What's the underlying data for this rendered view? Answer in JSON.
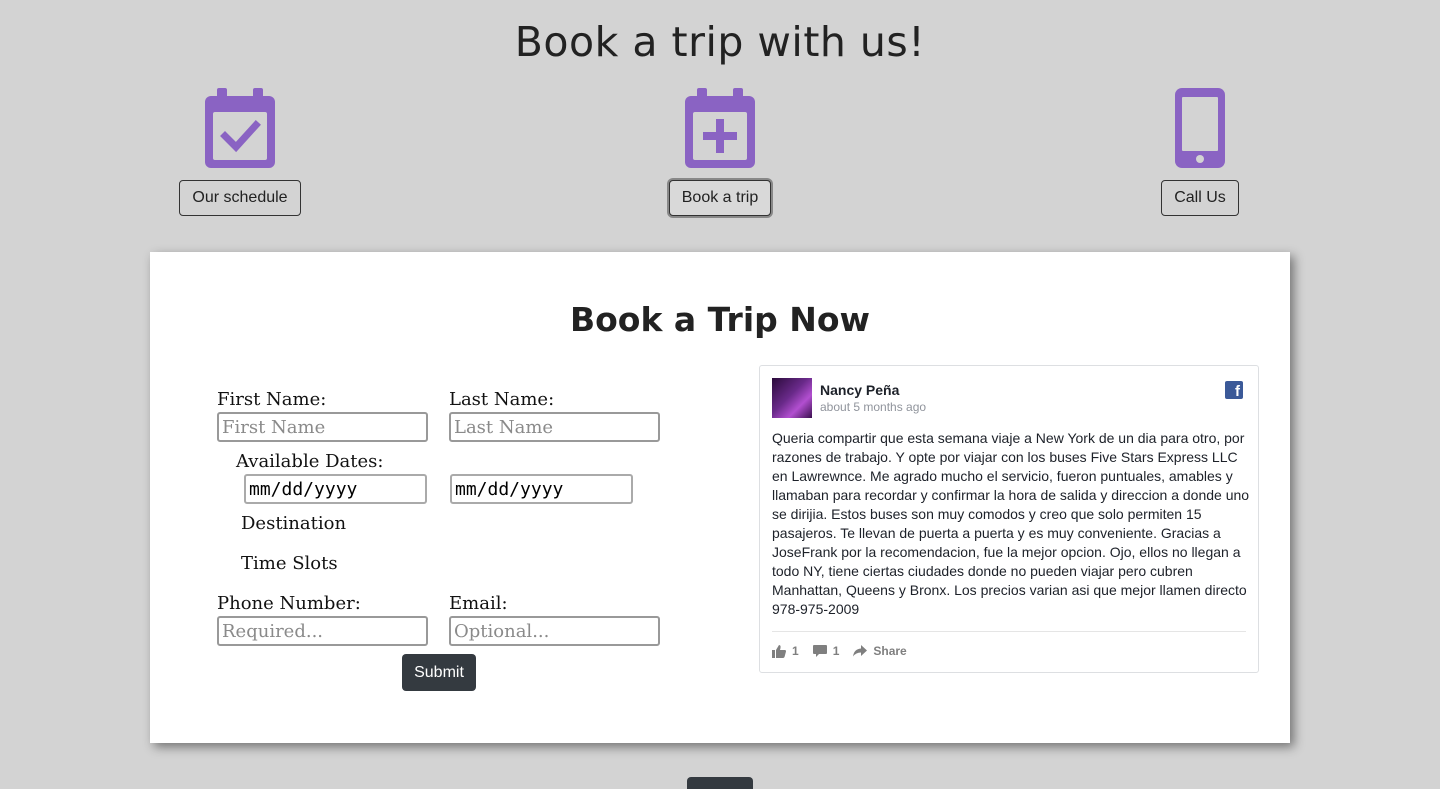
{
  "header": {
    "title": "Book a trip with us!"
  },
  "nav": {
    "schedule_label": "Our schedule",
    "book_label": "Book a trip",
    "call_label": "Call Us",
    "icon_color": "#8a63c3"
  },
  "booking": {
    "title": "Book a Trip Now",
    "first_name_label": "First Name:",
    "first_name_placeholder": "First Name",
    "last_name_label": "Last Name:",
    "last_name_placeholder": "Last Name",
    "dates_label": "Available Dates:",
    "date_from": "mm/dd/yyyy",
    "date_to": "mm/dd/yyyy",
    "destination_label": "Destination",
    "time_slots_label": "Time Slots",
    "phone_label": "Phone Number:",
    "phone_placeholder": "Required...",
    "email_label": "Email:",
    "email_placeholder": "Optional...",
    "submit_label": "Submit"
  },
  "review": {
    "author": "Nancy Peña",
    "time": "about 5 months ago",
    "text": "Queria compartir que esta semana viaje a New York de un dia para otro, por razones de trabajo. Y opte por viajar con los buses Five Stars Express LLC en Lawrewnce. Me agrado mucho el servicio, fueron puntuales, amables y llamaban para recordar y confirmar la hora de salida y direccion a donde uno se dirijia. Estos buses son muy comodos y creo que solo permiten 15 pasajeros. Te llevan de puerta a puerta y es muy conveniente. Gracias a JoseFrank por la recomendacion, fue la mejor opcion. Ojo, ellos no llegan a todo NY, tiene ciertas ciudades donde no pueden viajar pero cubren Manhattan, Queens y Bronx. Los precios varian asi que mejor llamen directo 978-975-2009",
    "likes": "1",
    "comments": "1",
    "share_label": "Share",
    "fb_color": "#3b5998"
  }
}
